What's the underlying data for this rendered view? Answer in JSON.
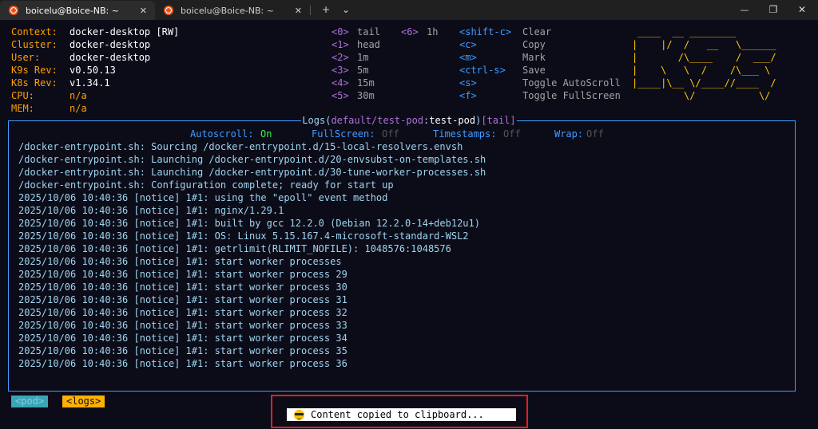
{
  "tabs": [
    {
      "title": "boicelu@Boice-NB: ~",
      "close": "✕"
    },
    {
      "title": "boicelu@Boice-NB: ~",
      "close": "✕"
    }
  ],
  "titlebar": {
    "new_tab": "+",
    "dropdown": "⌄",
    "minimize": "—",
    "maximize": "❐",
    "close": "✕"
  },
  "header": {
    "context_label": "Context:",
    "context_value": "docker-desktop [RW]",
    "cluster_label": "Cluster:",
    "cluster_value": "docker-desktop",
    "user_label": "User:",
    "user_value": "docker-desktop",
    "k9s_rev_label": "K9s Rev:",
    "k9s_rev_value": "v0.50.13",
    "k8s_rev_label": "K8s Rev:",
    "k8s_rev_value": "v1.34.1",
    "cpu_label": "CPU:",
    "cpu_value": "n/a",
    "mem_label": "MEM:",
    "mem_value": "n/a"
  },
  "menu_col1": [
    {
      "key": "<0>",
      "label": "tail"
    },
    {
      "key": "<1>",
      "label": "head"
    },
    {
      "key": "<2>",
      "label": "1m"
    },
    {
      "key": "<3>",
      "label": "5m"
    },
    {
      "key": "<4>",
      "label": "15m"
    },
    {
      "key": "<5>",
      "label": "30m"
    }
  ],
  "menu_col2": [
    {
      "key": "<6>",
      "label": "1h"
    }
  ],
  "menu_col3": [
    {
      "key": "<shift-c>",
      "label": "Clear"
    },
    {
      "key": "<c>",
      "label": "Copy"
    },
    {
      "key": "<m>",
      "label": "Mark"
    },
    {
      "key": "<ctrl-s>",
      "label": "Save"
    },
    {
      "key": "<s>",
      "label": "Toggle AutoScroll"
    },
    {
      "key": "<f>",
      "label": "Toggle FullScreen"
    }
  ],
  "logo_lines": [
    " ____  __ ________",
    "|    |/  /   __   \\______",
    "|       /\\____    /  ___/",
    "|    \\   \\  /    /\\___ \\",
    "|____|\\__ \\/____//____  /",
    "         \\/           \\/"
  ],
  "logs_title": {
    "prefix": " Logs(",
    "namespace": "default/test-pod",
    "colon": ":",
    "container": "test-pod",
    "close_paren": ")",
    "mode": "[tail]",
    "suffix": " "
  },
  "settings": {
    "autoscroll_label": "Autoscroll:",
    "autoscroll_value": "On",
    "fullscreen_label": "FullScreen:",
    "fullscreen_value": "Off",
    "timestamps_label": "Timestamps:",
    "timestamps_value": "Off",
    "wrap_label": "Wrap:",
    "wrap_value": "Off"
  },
  "log_lines": [
    "/docker-entrypoint.sh: Sourcing /docker-entrypoint.d/15-local-resolvers.envsh",
    "/docker-entrypoint.sh: Launching /docker-entrypoint.d/20-envsubst-on-templates.sh",
    "/docker-entrypoint.sh: Launching /docker-entrypoint.d/30-tune-worker-processes.sh",
    "/docker-entrypoint.sh: Configuration complete; ready for start up",
    "2025/10/06 10:40:36 [notice] 1#1: using the \"epoll\" event method",
    "2025/10/06 10:40:36 [notice] 1#1: nginx/1.29.1",
    "2025/10/06 10:40:36 [notice] 1#1: built by gcc 12.2.0 (Debian 12.2.0-14+deb12u1)",
    "2025/10/06 10:40:36 [notice] 1#1: OS: Linux 5.15.167.4-microsoft-standard-WSL2",
    "2025/10/06 10:40:36 [notice] 1#1: getrlimit(RLIMIT_NOFILE): 1048576:1048576",
    "2025/10/06 10:40:36 [notice] 1#1: start worker processes",
    "2025/10/06 10:40:36 [notice] 1#1: start worker process 29",
    "2025/10/06 10:40:36 [notice] 1#1: start worker process 30",
    "2025/10/06 10:40:36 [notice] 1#1: start worker process 31",
    "2025/10/06 10:40:36 [notice] 1#1: start worker process 32",
    "2025/10/06 10:40:36 [notice] 1#1: start worker process 33",
    "2025/10/06 10:40:36 [notice] 1#1: start worker process 34",
    "2025/10/06 10:40:36 [notice] 1#1: start worker process 35",
    "2025/10/06 10:40:36 [notice] 1#1: start worker process 36"
  ],
  "breadcrumbs": [
    "<pod>",
    "<logs>"
  ],
  "flash_message": "Content copied to clipboard...",
  "colors": {
    "accent": "#3f9bff",
    "label": "#ff9d00",
    "key": "#b26fdb",
    "logo": "#ffc800",
    "flash_frame": "#e02020"
  }
}
